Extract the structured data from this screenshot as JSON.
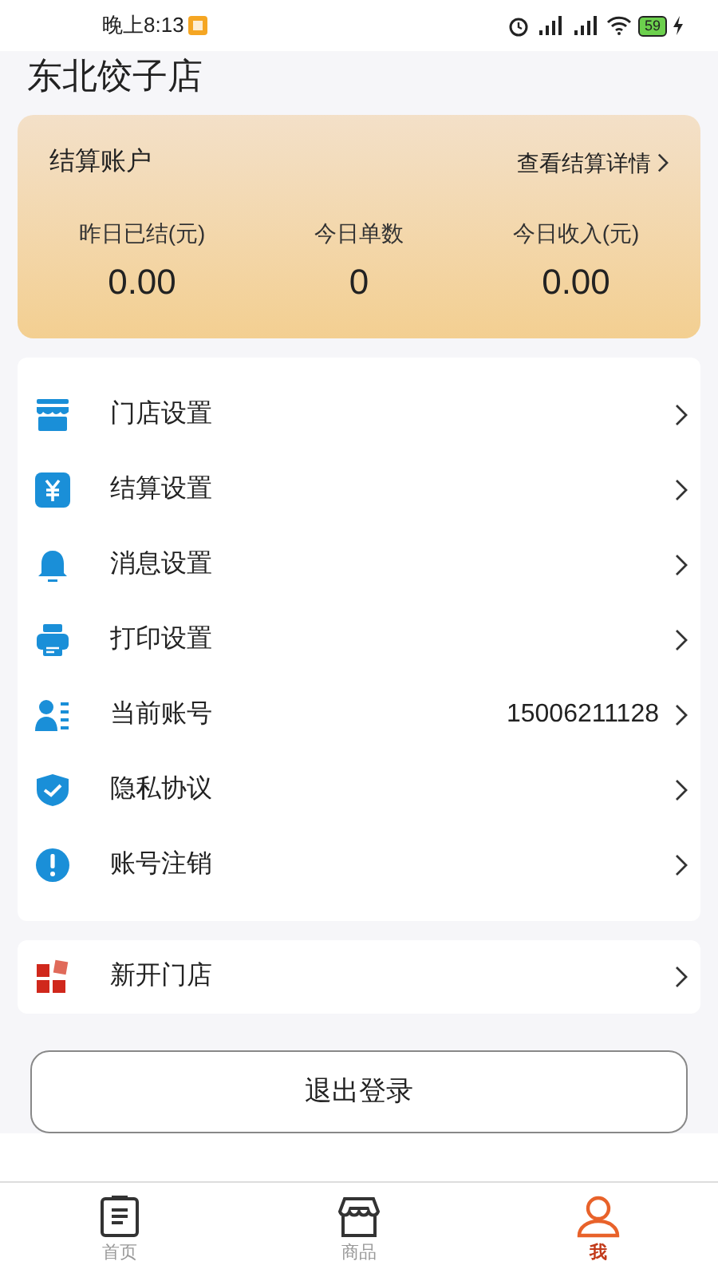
{
  "status_bar": {
    "time": "晚上8:13",
    "battery": "59"
  },
  "store_name": "东北饺子店",
  "account_card": {
    "title": "结算账户",
    "link": "查看结算详情",
    "stats": [
      {
        "label": "昨日已结(元)",
        "value": "0.00"
      },
      {
        "label": "今日单数",
        "value": "0"
      },
      {
        "label": "今日收入(元)",
        "value": "0.00"
      }
    ]
  },
  "settings": [
    {
      "label": "门店设置"
    },
    {
      "label": "结算设置"
    },
    {
      "label": "消息设置"
    },
    {
      "label": "打印设置"
    },
    {
      "label": "当前账号",
      "value": "15006211128"
    },
    {
      "label": "隐私协议"
    },
    {
      "label": "账号注销"
    }
  ],
  "new_store": {
    "label": "新开门店"
  },
  "logout_button": "退出登录",
  "tab_bar": [
    {
      "label": "首页",
      "selected": false
    },
    {
      "label": "商品",
      "selected": false
    },
    {
      "label": "我",
      "selected": true
    }
  ]
}
